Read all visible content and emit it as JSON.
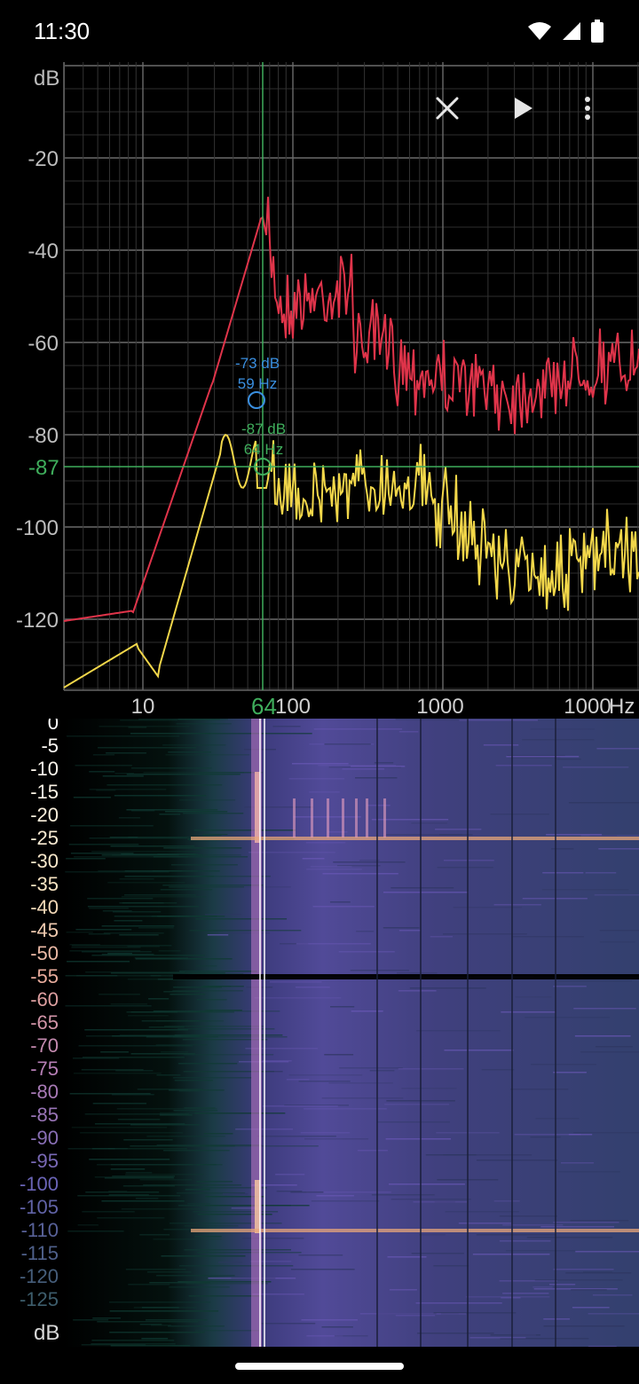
{
  "status_bar": {
    "time": "11:30"
  },
  "spectrum": {
    "y_unit": "dB",
    "x_unit": "Hz",
    "y_ticks": [
      "-20",
      "-40",
      "-60",
      "-80",
      "-100",
      "-120"
    ],
    "cursor_y_label": "-87",
    "cursor_x_label": "64",
    "x_ticks": [
      "10",
      "100",
      "1000",
      "1000"
    ],
    "markers": [
      {
        "db": "-73 dB",
        "hz": "59 Hz"
      },
      {
        "db": "-87 dB",
        "hz": "64 Hz"
      }
    ],
    "colors": {
      "peak": "#e0344a",
      "live": "#f2d74a",
      "marker_peak": "#3a8fe0",
      "marker_live": "#3fae5c",
      "grid": "#555555"
    }
  },
  "spectrogram": {
    "y_unit": "dB",
    "scale_labels": [
      "0",
      "-5",
      "-10",
      "-15",
      "-20",
      "-25",
      "-30",
      "-35",
      "-40",
      "-45",
      "-50",
      "-55",
      "-60",
      "-65",
      "-70",
      "-75",
      "-80",
      "-85",
      "-90",
      "-95",
      "-100",
      "-105",
      "-110",
      "-115",
      "-120",
      "-125"
    ]
  },
  "toolbar": {
    "icons": [
      "close-icon",
      "play-icon",
      "more-vert-icon"
    ]
  }
}
